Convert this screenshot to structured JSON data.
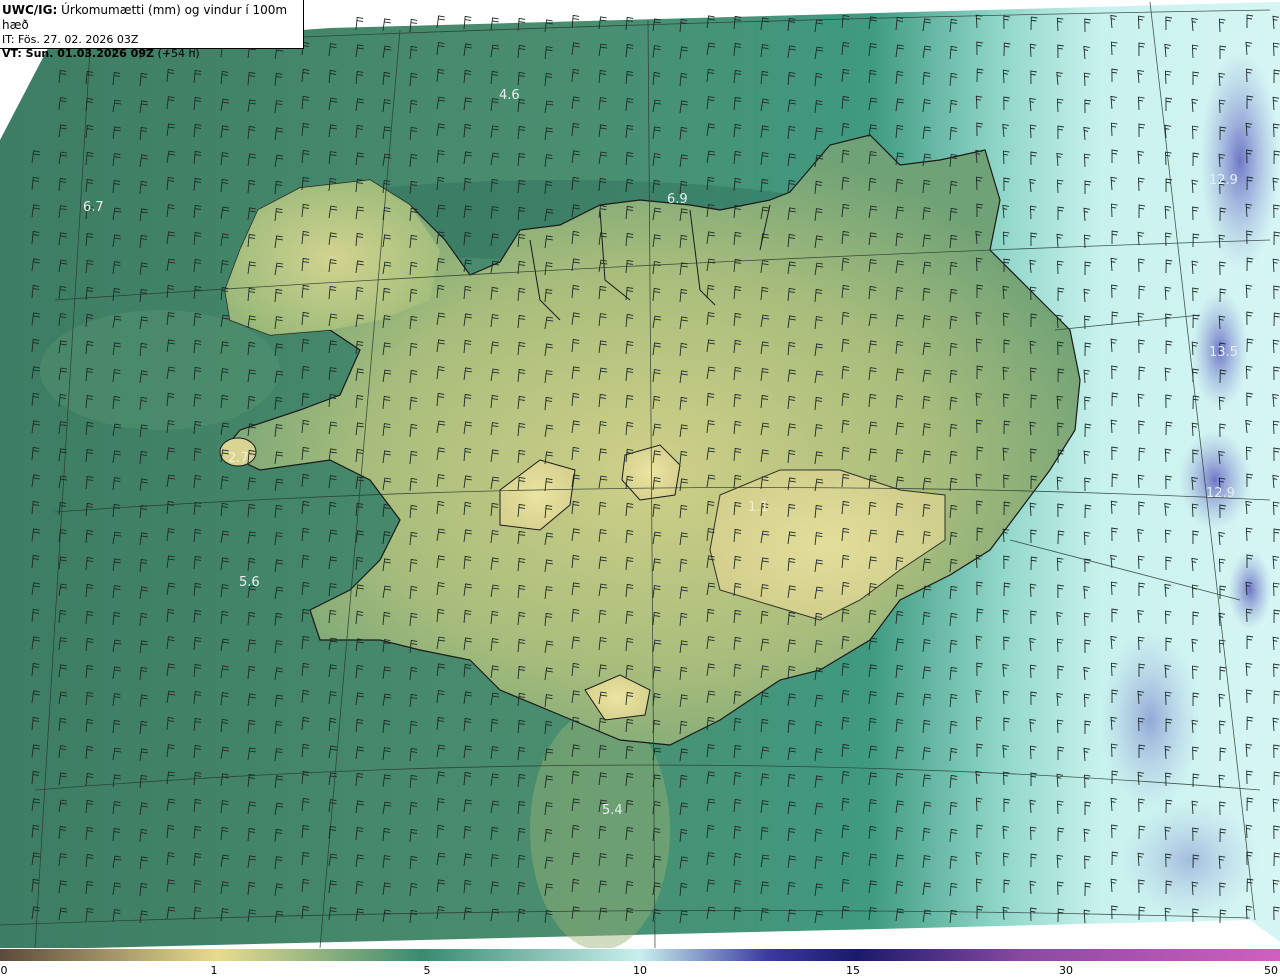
{
  "info_box": {
    "model": "UWC/IG:",
    "title": "Úrkomumætti (mm) og vindur í 100m hæð",
    "init_prefix": "IT: ",
    "init_time": "Fös. 27. 02. 2026 03Z",
    "valid_prefix": "VT: ",
    "valid_time": "Sun. 01.03.2026 09Z",
    "lead_time": "(+54 h)"
  },
  "map_labels": [
    {
      "id": "label-nw-sea",
      "text": "4.6"
    },
    {
      "id": "label-far-west",
      "text": "6.7"
    },
    {
      "id": "label-north-coast",
      "text": "6.9"
    },
    {
      "id": "label-east-1",
      "text": "12.9"
    },
    {
      "id": "label-east-2",
      "text": "13.5"
    },
    {
      "id": "label-east-3",
      "text": "12.9"
    },
    {
      "id": "label-west-sea",
      "text": "5.6"
    },
    {
      "id": "label-south-sea",
      "text": "5.4"
    },
    {
      "id": "label-snaefells",
      "text": "2.7"
    },
    {
      "id": "label-vatnajokull",
      "text": "1.1"
    }
  ],
  "colorbar": {
    "ticks": [
      "0",
      "1",
      "5",
      "10",
      "15",
      "30",
      "50"
    ],
    "colors": {
      "start": "#5a4a3a",
      "light": "#e8dc90",
      "mid": "#3a8a70",
      "cyan": "#c8f0ee",
      "blue": "#3a3aa0",
      "navy": "#1a1a6a",
      "violet": "#8a4aa0",
      "magenta": "#d060c0"
    }
  },
  "colors": {
    "sea_dark": "#2f7c68",
    "sea_mid": "#4a9a80",
    "land_low": "#8ab070",
    "land_high": "#e0d890",
    "east_cyan": "#b8eeea",
    "east_blue": "#6a70c0"
  }
}
